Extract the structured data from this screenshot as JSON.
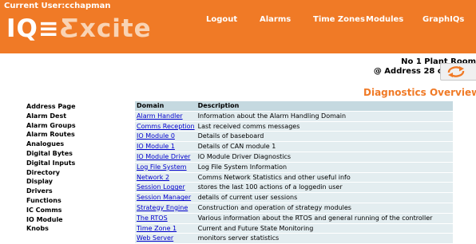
{
  "header": {
    "current_user": "Current User:cchapman",
    "logo_left": "IQ≡",
    "logo_right": "Ƹxcite",
    "nav": [
      "Logout",
      "Alarms",
      "Time Zones",
      "Modules",
      "GraphIQs"
    ],
    "plant_line1": "No 1 Plant Room",
    "plant_line2": "@ Address 28 on Lan 2"
  },
  "colors": {
    "brand": "#f07a26",
    "table_header": "#c5d9e0",
    "table_row": "#e3edf0",
    "link": "#0000cc"
  },
  "page_title": "Diagnostics Overview",
  "sidebar": [
    "Address Page",
    "Alarm Dest",
    "Alarm Groups",
    "Alarm Routes",
    "Analogues",
    "Digital Bytes",
    "Digital Inputs",
    "Directory",
    "Display",
    "Drivers",
    "Functions",
    "IC Comms",
    "IO Module",
    "Knobs"
  ],
  "table": {
    "headers": [
      "Domain",
      "Description"
    ],
    "rows": [
      {
        "domain": "Alarm Handler",
        "description": "Information about the Alarm Handling Domain"
      },
      {
        "domain": "Comms Reception",
        "description": "Last received comms messages"
      },
      {
        "domain": "IO Module 0",
        "description": "Details of baseboard"
      },
      {
        "domain": "IO Module 1",
        "description": "Details of CAN module 1"
      },
      {
        "domain": "IO Module Driver",
        "description": "IO Module Driver Diagnostics"
      },
      {
        "domain": "Log File System",
        "description": "Log File System Information"
      },
      {
        "domain": "Network 2",
        "description": "Comms Network Statistics and other useful info"
      },
      {
        "domain": "Session Logger",
        "description": "stores the last 100 actions of a loggedin user"
      },
      {
        "domain": "Session Manager",
        "description": "details of current user sessions"
      },
      {
        "domain": "Strategy Engine",
        "description": "Construction and operation of strategy modules"
      },
      {
        "domain": "The RTOS",
        "description": "Various information about the RTOS and general running of the controller"
      },
      {
        "domain": "Time Zone 1",
        "description": "Current and Future State Monitoring"
      },
      {
        "domain": "Web Server",
        "description": "monitors server statistics"
      }
    ]
  }
}
